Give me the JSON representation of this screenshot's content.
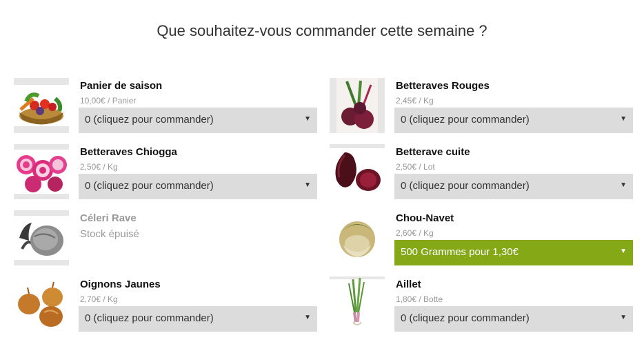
{
  "title": "Que souhaitez-vous commander cette semaine ?",
  "products": [
    {
      "name": "Panier de saison",
      "price": "10,00€ / Panier",
      "select": "0 (cliquez pour commander)"
    },
    {
      "name": "Betteraves Rouges",
      "price": "2,45€ / Kg",
      "select": "0 (cliquez pour commander)"
    },
    {
      "name": "Betteraves Chiogga",
      "price": "2,50€ / Kg",
      "select": "0 (cliquez pour commander)"
    },
    {
      "name": "Betterave cuite",
      "price": "2,50€ / Lot",
      "select": "0 (cliquez pour commander)"
    },
    {
      "name": "Céleri Rave",
      "stock": "Stock épuisé"
    },
    {
      "name": "Chou-Navet",
      "price": "2,60€ / Kg",
      "select": "500 Grammes pour 1,30€"
    },
    {
      "name": "Oignons Jaunes",
      "price": "2,70€ / Kg",
      "select": "0 (cliquez pour commander)"
    },
    {
      "name": "Aillet",
      "price": "1,80€ / Botte",
      "select": "0 (cliquez pour commander)"
    }
  ],
  "select_arrow": "▼",
  "colors": {
    "accent": "#85a817",
    "select_bg": "#dcdcdc",
    "muted": "#999999"
  }
}
